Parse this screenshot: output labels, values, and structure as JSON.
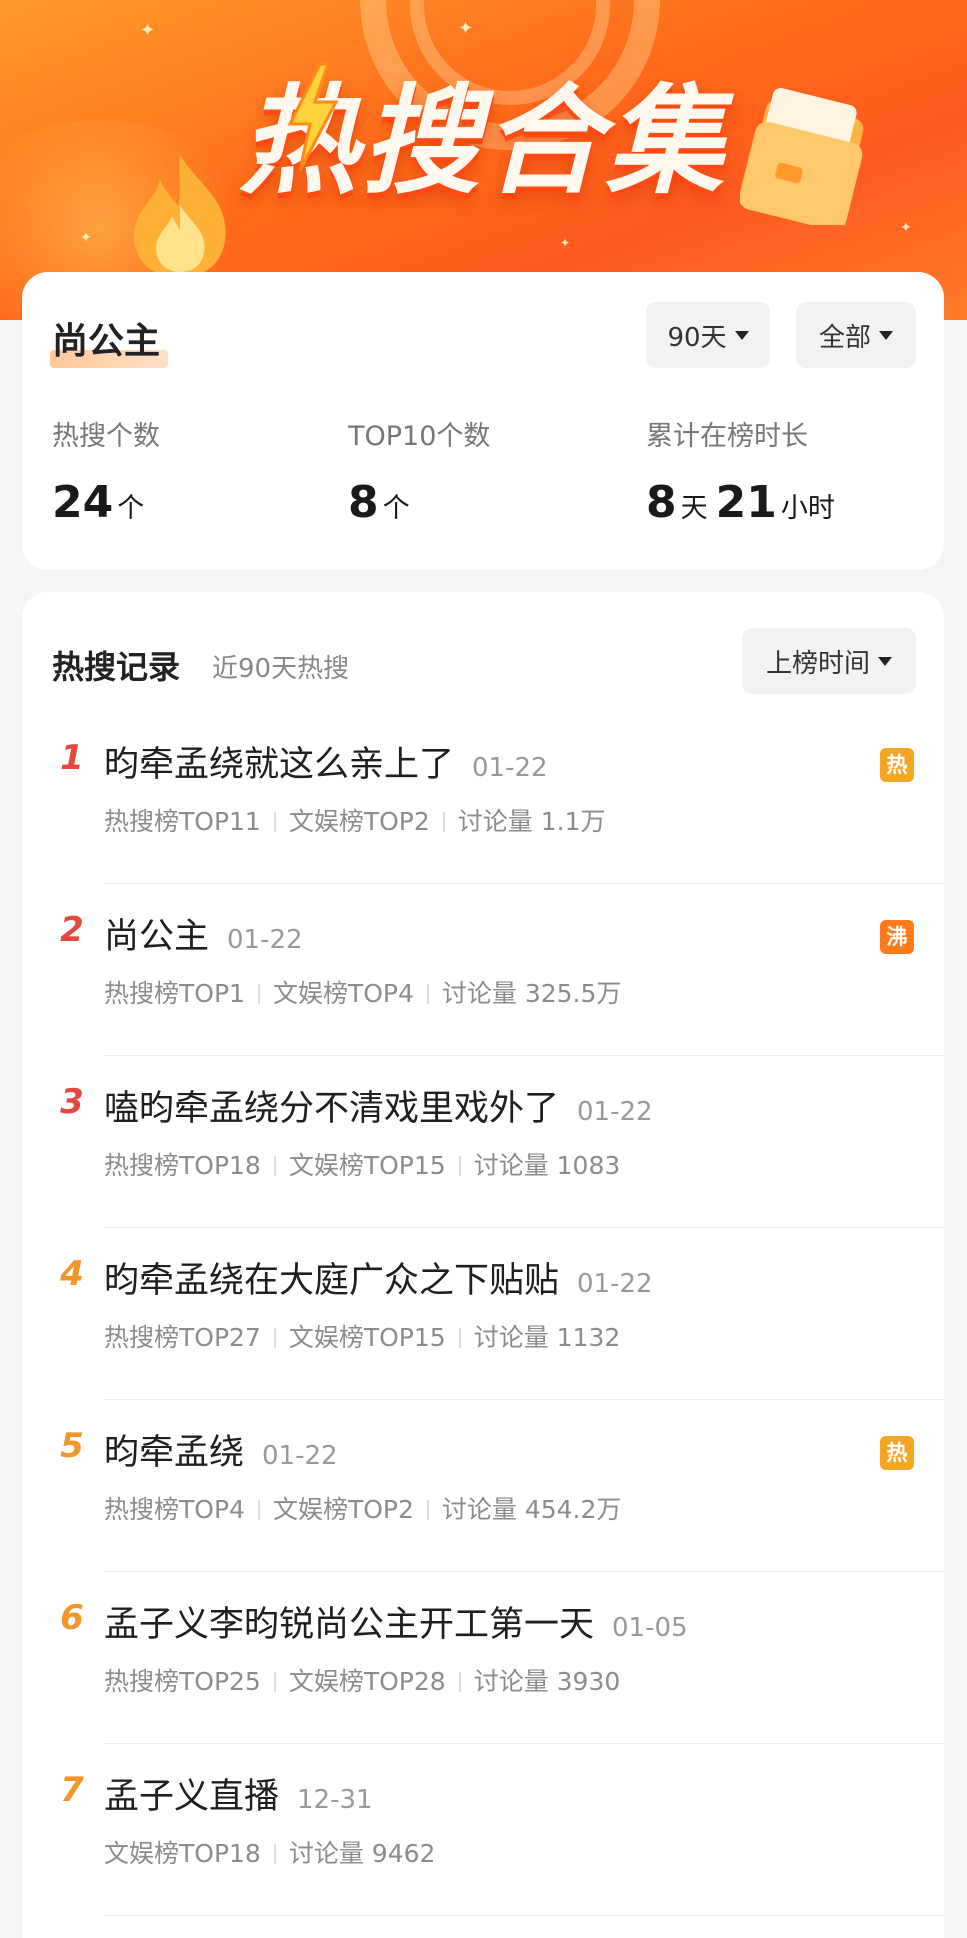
{
  "banner": {
    "title": "热搜合集"
  },
  "summary": {
    "topic": "尚公主",
    "filters": {
      "days": "90天",
      "scope": "全部"
    },
    "stats": [
      {
        "label": "热搜个数",
        "parts": [
          {
            "num": "24",
            "unit": "个"
          }
        ]
      },
      {
        "label": "TOP10个数",
        "parts": [
          {
            "num": "8",
            "unit": "个"
          }
        ]
      },
      {
        "label": "累计在榜时长",
        "parts": [
          {
            "num": "8",
            "unit": "天"
          },
          {
            "num": "21",
            "unit": "小时"
          }
        ]
      }
    ]
  },
  "records": {
    "title": "热搜记录",
    "subtitle": "近90天热搜",
    "sort": "上榜时间",
    "items": [
      {
        "rank": "1",
        "title": "昀牵孟绕就这么亲上了",
        "date": "01-22",
        "badge": "热",
        "badge_type": "hot",
        "meta": [
          "热搜榜TOP11",
          "文娱榜TOP2",
          "讨论量 1.1万"
        ]
      },
      {
        "rank": "2",
        "title": "尚公主",
        "date": "01-22",
        "badge": "沸",
        "badge_type": "boil",
        "meta": [
          "热搜榜TOP1",
          "文娱榜TOP4",
          "讨论量 325.5万"
        ]
      },
      {
        "rank": "3",
        "title": "嗑昀牵孟绕分不清戏里戏外了",
        "date": "01-22",
        "badge": "",
        "badge_type": "",
        "meta": [
          "热搜榜TOP18",
          "文娱榜TOP15",
          "讨论量 1083"
        ]
      },
      {
        "rank": "4",
        "title": "昀牵孟绕在大庭广众之下贴贴",
        "date": "01-22",
        "badge": "",
        "badge_type": "",
        "meta": [
          "热搜榜TOP27",
          "文娱榜TOP15",
          "讨论量 1132"
        ]
      },
      {
        "rank": "5",
        "title": "昀牵孟绕",
        "date": "01-22",
        "badge": "热",
        "badge_type": "hot",
        "meta": [
          "热搜榜TOP4",
          "文娱榜TOP2",
          "讨论量 454.2万"
        ]
      },
      {
        "rank": "6",
        "title": "孟子义李昀锐尚公主开工第一天",
        "date": "01-05",
        "badge": "",
        "badge_type": "",
        "meta": [
          "热搜榜TOP25",
          "文娱榜TOP28",
          "讨论量 3930"
        ]
      },
      {
        "rank": "7",
        "title": "孟子义直播",
        "date": "12-31",
        "badge": "",
        "badge_type": "",
        "meta": [
          "文娱榜TOP18",
          "讨论量 9462"
        ]
      }
    ]
  }
}
